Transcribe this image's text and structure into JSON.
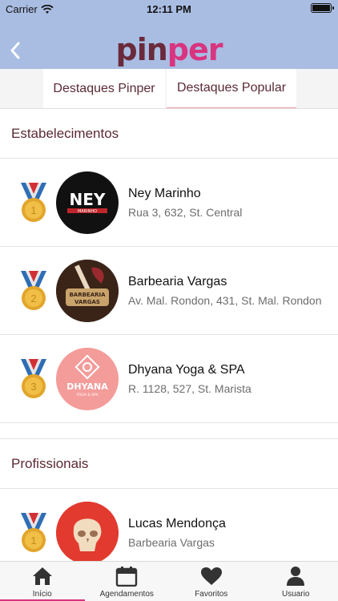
{
  "status": {
    "carrier": "Carrier",
    "time": "12:11 PM"
  },
  "header": {
    "logo_part1": "pin",
    "logo_part2": "per"
  },
  "tabs": [
    {
      "label": "Destaques Pinper"
    },
    {
      "label": "Destaques Popular"
    }
  ],
  "sections": {
    "establishments_title": "Estabelecimentos",
    "professionals_title": "Profissionais"
  },
  "establishments": [
    {
      "rank": "1",
      "name": "Ney Marinho",
      "address": "Rua 3, 632, St. Central",
      "logo_text": "NEY",
      "logo_sub": "MARINHO"
    },
    {
      "rank": "2",
      "name": "Barbearia Vargas",
      "address": "Av. Mal. Rondon, 431, St. Mal. Rondon",
      "logo_text": "BARBEARIA",
      "logo_sub": "VARGAS"
    },
    {
      "rank": "3",
      "name": "Dhyana Yoga & SPA",
      "address": "R. 1128, 527, St. Marista",
      "logo_text": "DHYANA",
      "logo_sub": "YOGA & SPA"
    }
  ],
  "professionals": [
    {
      "rank": "1",
      "name": "Lucas Mendonça",
      "address": "Barbearia Vargas"
    }
  ],
  "nav": [
    {
      "label": "Início",
      "icon": "home-icon"
    },
    {
      "label": "Agendamentos",
      "icon": "calendar-icon"
    },
    {
      "label": "Favoritos",
      "icon": "heart-icon"
    },
    {
      "label": "Usuario",
      "icon": "user-icon"
    }
  ],
  "colors": {
    "header_bg": "#a9bde3",
    "accent": "#d8347f",
    "brand_dark": "#6a2a3c",
    "medal_gold": "#e2a52b"
  }
}
